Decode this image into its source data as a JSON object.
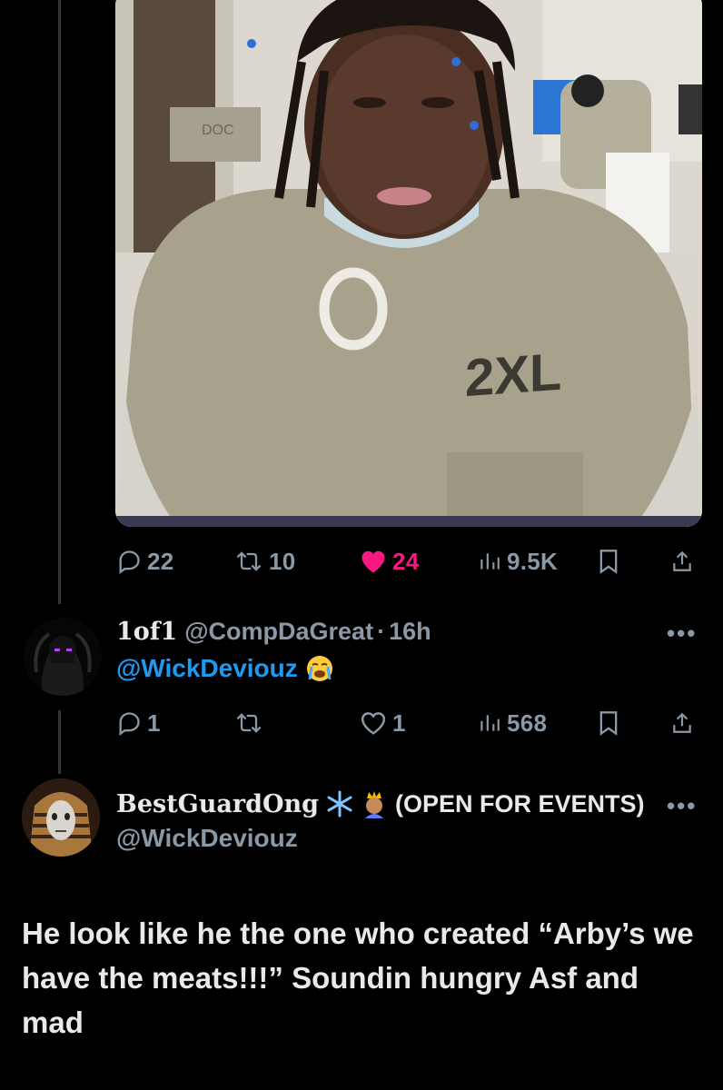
{
  "tweet": {
    "stats": {
      "replies": "22",
      "reposts": "10",
      "likes": "24",
      "views": "9.5K"
    }
  },
  "reply1": {
    "display_name": "1of1",
    "handle": "@CompDaGreat",
    "separator": "·",
    "time": "16h",
    "mention": "@WickDeviouz",
    "emoji": "loudly-crying-face",
    "stats": {
      "replies": "1",
      "reposts": "",
      "likes": "1",
      "views": "568"
    }
  },
  "reply2": {
    "display_name": "BestGuardOng",
    "status": "(OPEN FOR EVENTS)",
    "handle": "@WickDeviouz",
    "text": "He look like he the one who created “Arby’s we have the meats!!!” Soundin hungry Asf and mad"
  },
  "photo": {
    "shirt_text": "2XL",
    "wall_text": "DOC"
  },
  "colors": {
    "background": "#000000",
    "text": "#e7e9ea",
    "muted": "#8b98a5",
    "link": "#1d9bf0",
    "like": "#f91880"
  }
}
